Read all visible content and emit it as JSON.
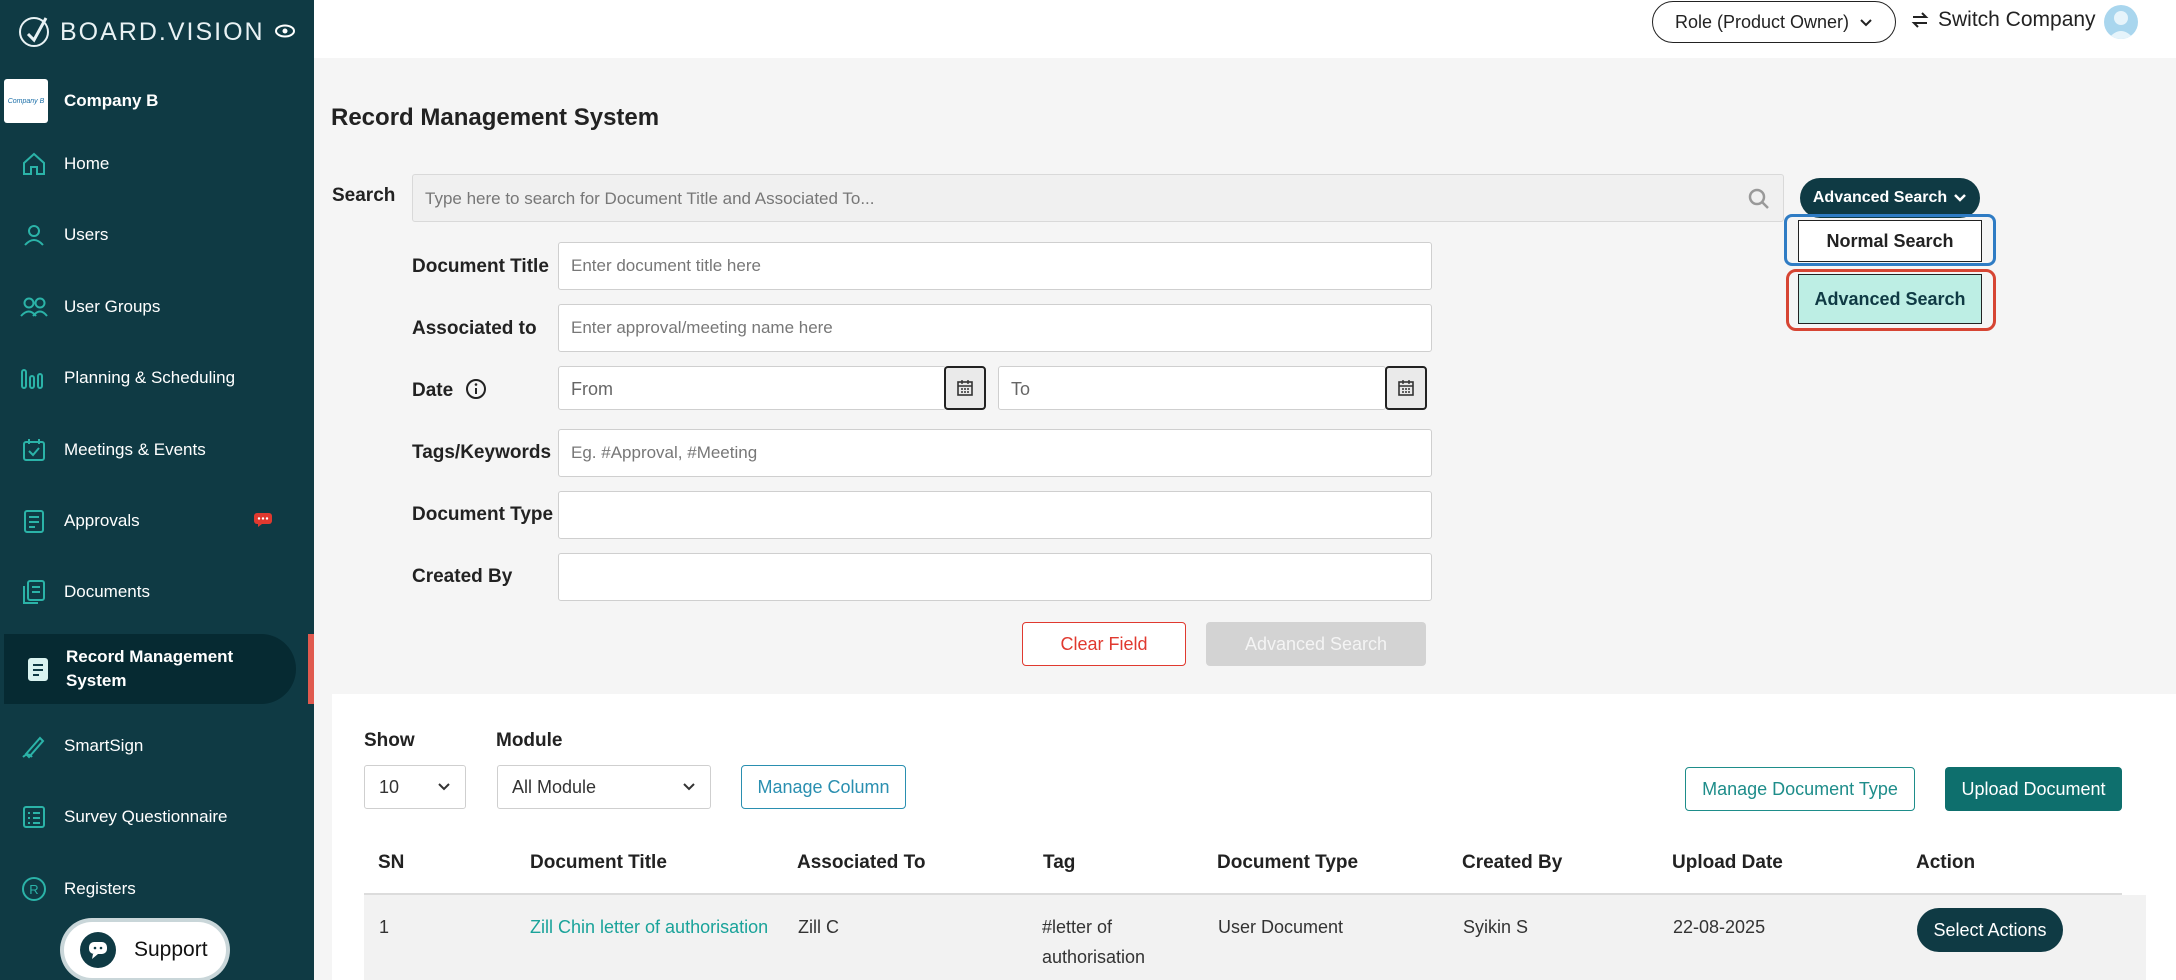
{
  "brand": {
    "name": "BOARD.VISION"
  },
  "company": {
    "logo_text": "Company B",
    "name": "Company B"
  },
  "sidebar": {
    "items": [
      {
        "label": "Home"
      },
      {
        "label": "Users"
      },
      {
        "label": "User Groups"
      },
      {
        "label": "Planning & Scheduling"
      },
      {
        "label": "Meetings & Events"
      },
      {
        "label": "Approvals"
      },
      {
        "label": "Documents"
      },
      {
        "label": "Record Management System"
      },
      {
        "label": "SmartSign"
      },
      {
        "label": "Survey Questionnaire"
      },
      {
        "label": "Registers"
      }
    ],
    "active": "Record Management System",
    "support_label": "Support"
  },
  "header": {
    "role_label": "Role (Product Owner)",
    "switch_label": "Switch Company"
  },
  "page": {
    "title": "Record Management System"
  },
  "search": {
    "label": "Search",
    "placeholder": "Type here to search for Document Title and Associated To...",
    "mode_button": "Advanced Search",
    "dropdown": {
      "normal": "Normal Search",
      "advanced": "Advanced Search"
    }
  },
  "form": {
    "document_title": {
      "label": "Document Title",
      "placeholder": "Enter document title here"
    },
    "associated_to": {
      "label": "Associated to",
      "placeholder": "Enter approval/meeting name here"
    },
    "date": {
      "label": "Date",
      "from_placeholder": "From",
      "to_placeholder": "To"
    },
    "tags": {
      "label": "Tags/Keywords",
      "placeholder": "Eg. #Approval, #Meeting"
    },
    "document_type": {
      "label": "Document Type",
      "value": ""
    },
    "created_by": {
      "label": "Created By",
      "value": ""
    },
    "clear_label": "Clear Field",
    "submit_label": "Advanced Search"
  },
  "table_controls": {
    "show_label": "Show",
    "show_value": "10",
    "module_label": "Module",
    "module_value": "All Module",
    "manage_column": "Manage Column",
    "manage_doc_type": "Manage Document Type",
    "upload": "Upload Document"
  },
  "table": {
    "columns": [
      "SN",
      "Document Title",
      "Associated To",
      "Tag",
      "Document Type",
      "Created By",
      "Upload Date",
      "Action"
    ],
    "rows": [
      {
        "sn": "1",
        "title": "Zill Chin letter of authorisation",
        "associated": "Zill C",
        "tag_line1": "#letter of",
        "tag_line2": "authorisation",
        "doc_type": "User Document",
        "created_by": "Syikin S",
        "upload_date": "22-08-2025",
        "action": "Select Actions"
      }
    ]
  },
  "colors": {
    "sidebar_bg": "#0f3a44",
    "accent_teal": "#0e6f6d",
    "link": "#1aa39a",
    "danger": "#e0392f",
    "highlight_blue": "#2f7cc4",
    "highlight_red": "#d64533",
    "selected_bg": "#bdeee4"
  }
}
